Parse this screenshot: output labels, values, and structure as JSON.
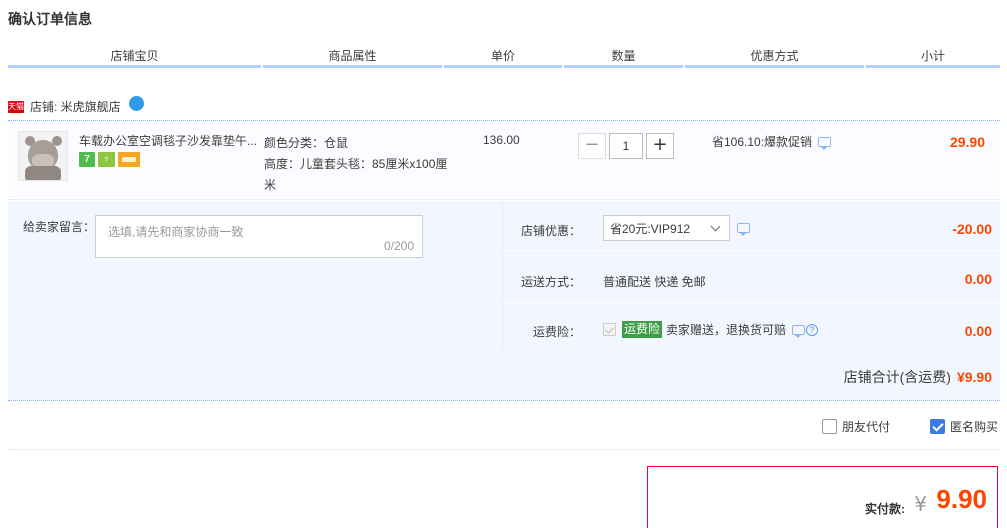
{
  "page": {
    "title": "确认订单信息"
  },
  "columns": [
    "店铺宝贝",
    "商品属性",
    "单价",
    "数量",
    "优惠方式",
    "小计"
  ],
  "shop": {
    "badge": "天猫",
    "label": "店铺: 米虎旗舰店"
  },
  "item": {
    "title": "车载办公室空调毯子沙发靠垫午...",
    "attr_color": "颜色分类：仓鼠",
    "attr_height": "高度：儿童套头毯：85厘米x100厘米",
    "unit_price": "136.00",
    "quantity": "1",
    "qty_minus": "−",
    "qty_plus": "+",
    "promotion": "省106.10:爆款促销",
    "subtotal": "29.90",
    "service_icon_1": "7",
    "service_icon_2": "♆"
  },
  "order": {
    "message_label": "给卖家留言：",
    "message_placeholder": "选填,请先和商家协商一致",
    "message_count": "0/200",
    "discount_label": "店铺优惠：",
    "discount_value": "省20元:VIP912",
    "discount_amount": "-20.00",
    "shipping_label": "运送方式：",
    "shipping_value": "普通配送 快递 免邮",
    "shipping_amount": "0.00",
    "insurance_label": "运费险：",
    "insurance_badge": "运费险",
    "insurance_text": "卖家赠送，退换货可赔",
    "insurance_help": "?",
    "insurance_amount": "0.00",
    "total_label": "店铺合计(含运费)",
    "total_value": "¥9.90"
  },
  "options": {
    "friend_pay": "朋友代付",
    "anonymous": "匿名购买"
  },
  "payment": {
    "label": "实付款:",
    "currency": "¥",
    "amount": "9.90"
  },
  "colors": {
    "price": "#ff4400",
    "header_line": "#b2d1ff",
    "box_bg": "#f2f7ff",
    "pay_border": "#ff0036"
  }
}
